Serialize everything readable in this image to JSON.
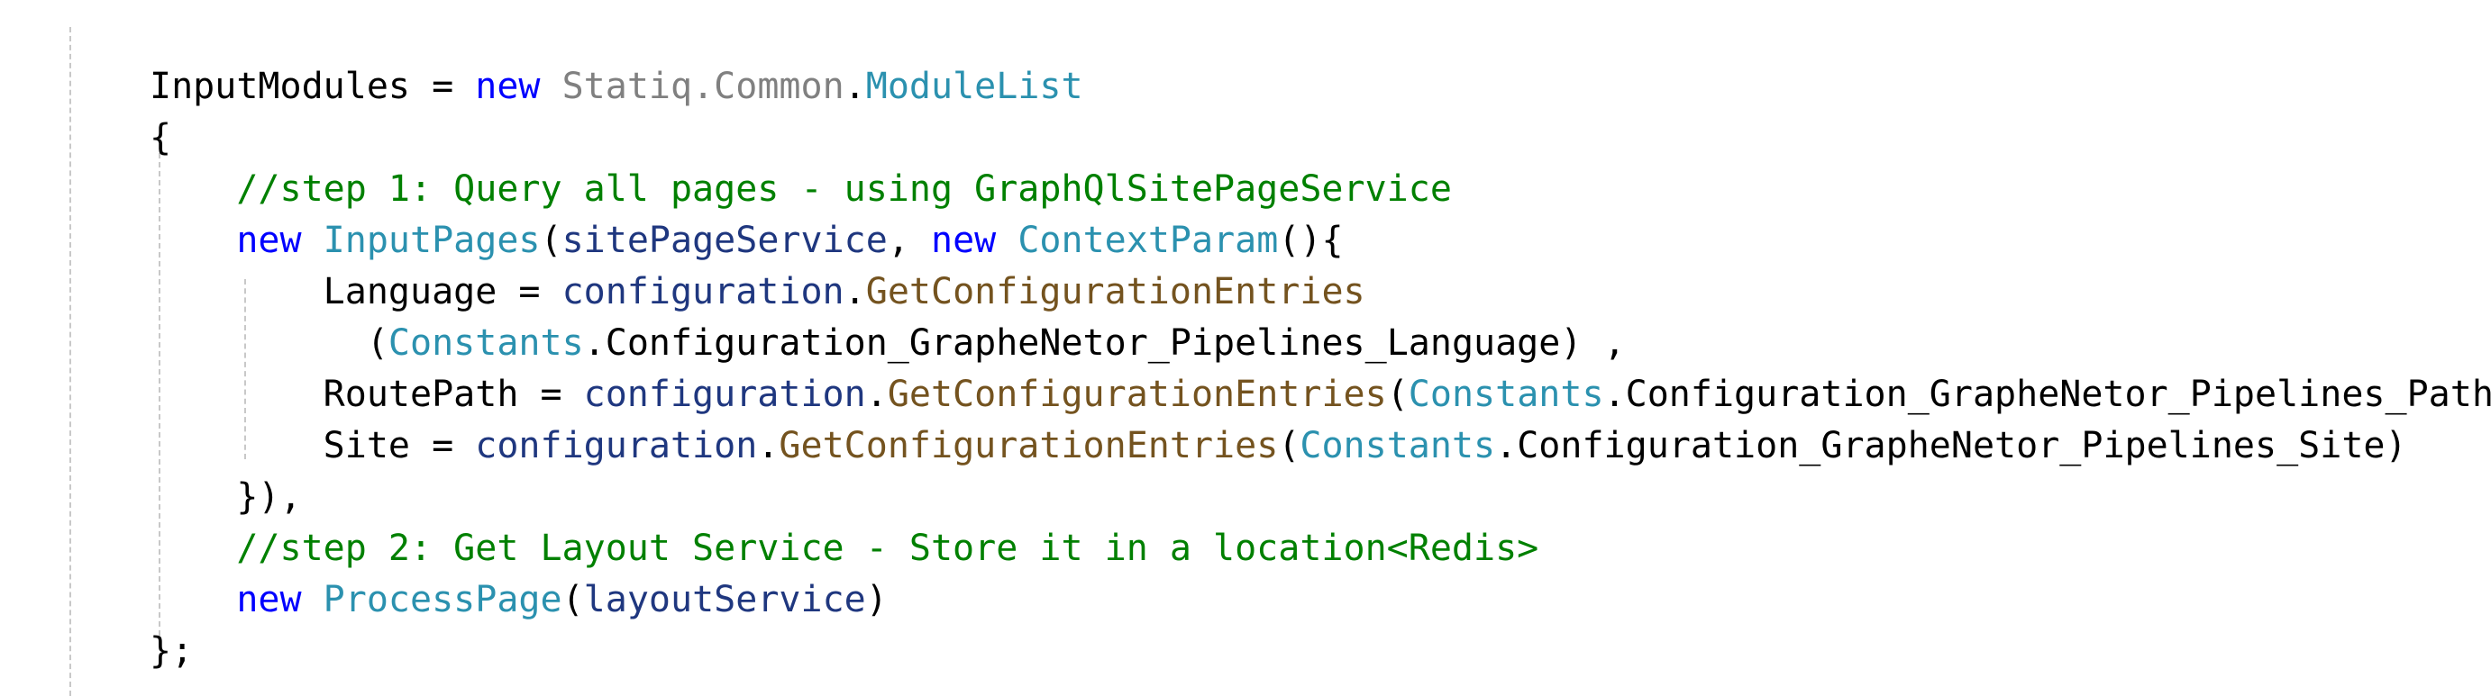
{
  "colors": {
    "background": "#ffffff",
    "plain": "#000000",
    "keyword": "#0000ff",
    "namespace": "#808080",
    "type": "#2b91af",
    "comment": "#008000",
    "variable": "#1f377f",
    "method": "#74531f",
    "indent_guide": "#c8c8c8"
  },
  "code_lines": [
    {
      "tokens": [
        {
          "text": "InputModules = ",
          "kind": "plain"
        },
        {
          "text": "new",
          "kind": "keyword"
        },
        {
          "text": " ",
          "kind": "plain"
        },
        {
          "text": "Statiq.Common",
          "kind": "namespace"
        },
        {
          "text": ".",
          "kind": "plain"
        },
        {
          "text": "ModuleList",
          "kind": "type"
        }
      ]
    },
    {
      "tokens": [
        {
          "text": "{",
          "kind": "plain"
        }
      ]
    },
    {
      "tokens": [
        {
          "text": "    ",
          "kind": "plain"
        },
        {
          "text": "//step 1: Query all pages - using GraphQlSitePageService",
          "kind": "comment"
        }
      ]
    },
    {
      "tokens": [
        {
          "text": "    ",
          "kind": "plain"
        },
        {
          "text": "new",
          "kind": "keyword"
        },
        {
          "text": " ",
          "kind": "plain"
        },
        {
          "text": "InputPages",
          "kind": "type"
        },
        {
          "text": "(",
          "kind": "plain"
        },
        {
          "text": "sitePageService",
          "kind": "variable"
        },
        {
          "text": ", ",
          "kind": "plain"
        },
        {
          "text": "new",
          "kind": "keyword"
        },
        {
          "text": " ",
          "kind": "plain"
        },
        {
          "text": "ContextParam",
          "kind": "type"
        },
        {
          "text": "(){",
          "kind": "plain"
        }
      ]
    },
    {
      "tokens": [
        {
          "text": "        Language = ",
          "kind": "plain"
        },
        {
          "text": "configuration",
          "kind": "variable"
        },
        {
          "text": ".",
          "kind": "plain"
        },
        {
          "text": "GetConfigurationEntries",
          "kind": "method"
        }
      ]
    },
    {
      "tokens": [
        {
          "text": "          (",
          "kind": "plain"
        },
        {
          "text": "Constants",
          "kind": "type"
        },
        {
          "text": ".Configuration_GrapheNetor_Pipelines_Language) ,",
          "kind": "plain"
        }
      ]
    },
    {
      "tokens": [
        {
          "text": "        RoutePath = ",
          "kind": "plain"
        },
        {
          "text": "configuration",
          "kind": "variable"
        },
        {
          "text": ".",
          "kind": "plain"
        },
        {
          "text": "GetConfigurationEntries",
          "kind": "method"
        },
        {
          "text": "(",
          "kind": "plain"
        },
        {
          "text": "Constants",
          "kind": "type"
        },
        {
          "text": ".Configuration_GrapheNetor_Pipelines_Path),",
          "kind": "plain"
        }
      ]
    },
    {
      "tokens": [
        {
          "text": "        Site = ",
          "kind": "plain"
        },
        {
          "text": "configuration",
          "kind": "variable"
        },
        {
          "text": ".",
          "kind": "plain"
        },
        {
          "text": "GetConfigurationEntries",
          "kind": "method"
        },
        {
          "text": "(",
          "kind": "plain"
        },
        {
          "text": "Constants",
          "kind": "type"
        },
        {
          "text": ".Configuration_GrapheNetor_Pipelines_Site)",
          "kind": "plain"
        }
      ]
    },
    {
      "tokens": [
        {
          "text": "    }),",
          "kind": "plain"
        }
      ]
    },
    {
      "tokens": [
        {
          "text": "    ",
          "kind": "plain"
        },
        {
          "text": "//step 2: Get Layout Service - Store it in a location<Redis>",
          "kind": "comment"
        }
      ]
    },
    {
      "tokens": [
        {
          "text": "    ",
          "kind": "plain"
        },
        {
          "text": "new",
          "kind": "keyword"
        },
        {
          "text": " ",
          "kind": "plain"
        },
        {
          "text": "ProcessPage",
          "kind": "type"
        },
        {
          "text": "(",
          "kind": "plain"
        },
        {
          "text": "layoutService",
          "kind": "variable"
        },
        {
          "text": ")",
          "kind": "plain"
        }
      ]
    },
    {
      "tokens": [
        {
          "text": "};",
          "kind": "plain"
        }
      ]
    }
  ]
}
